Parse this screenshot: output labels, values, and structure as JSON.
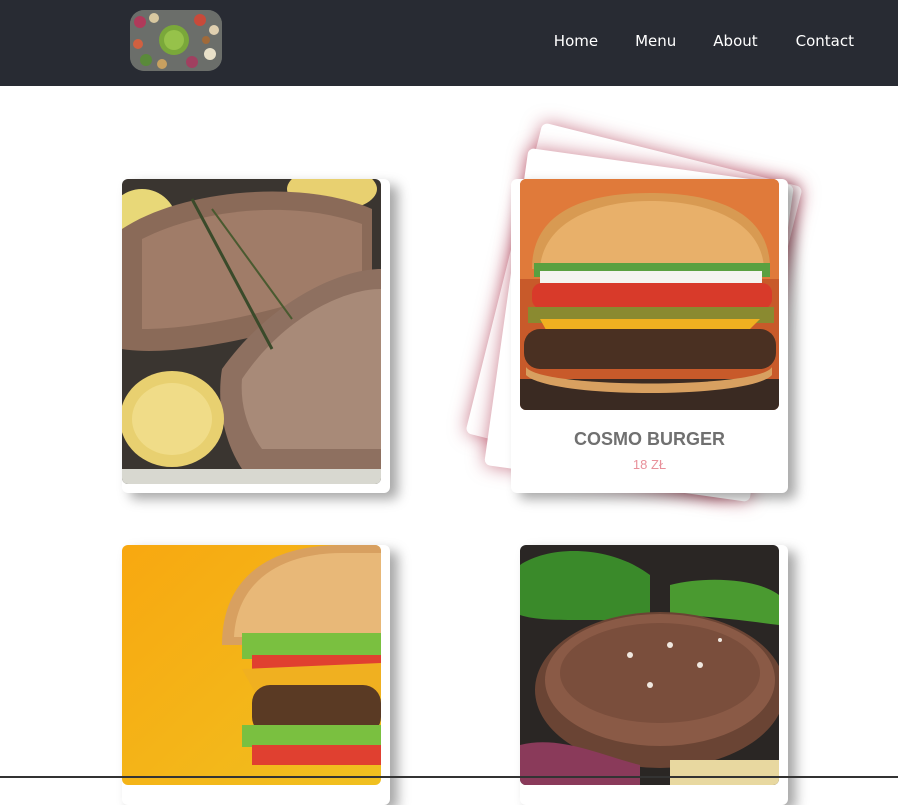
{
  "nav": {
    "logo_alt": "food bowls logo",
    "items": [
      {
        "label": "Home"
      },
      {
        "label": "Menu"
      },
      {
        "label": "About"
      },
      {
        "label": "Contact"
      }
    ]
  },
  "cards": [
    {
      "image": "grilled-steak-with-thyme-photo"
    },
    {
      "image": "cosmo-burger-photo",
      "title": "COSMO BURGER",
      "price": "18 ZŁ"
    },
    {
      "image": "double-cheeseburger-photo"
    },
    {
      "image": "seared-steak-with-basil-photo"
    }
  ],
  "colors": {
    "navbar": "#282b33",
    "price": "#e8909a",
    "title": "#707070",
    "hover_glow": "#a01432"
  }
}
